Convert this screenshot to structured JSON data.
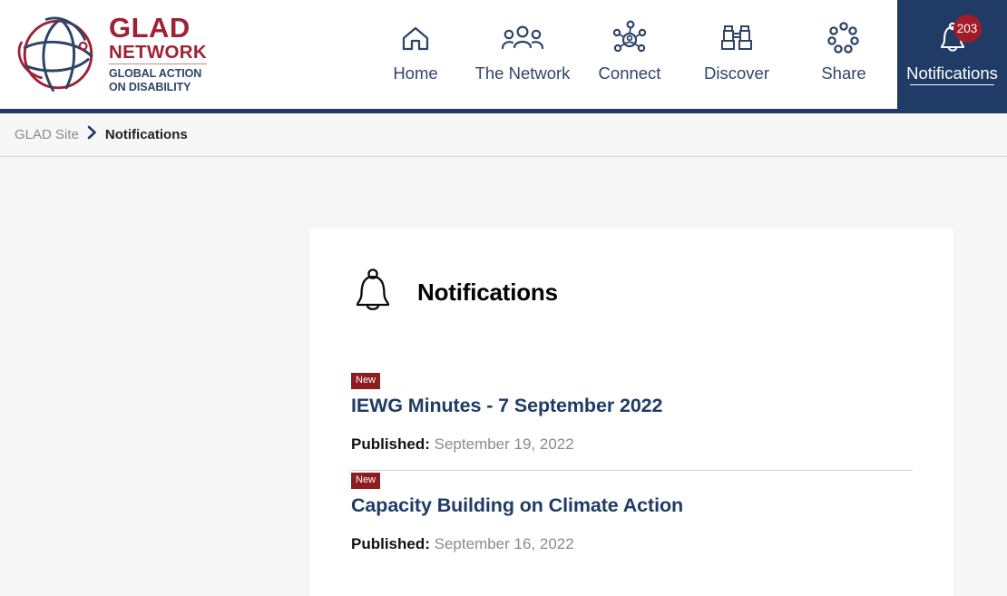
{
  "brand": {
    "logo_icon": "globe-logo-icon",
    "name_line1": "GLAD",
    "name_line2": "NETWORK",
    "tagline_line1": "GLOBAL ACTION",
    "tagline_line2": "ON DISABILITY",
    "primary_red": "#9e2235",
    "primary_navy": "#1f3b66"
  },
  "nav": {
    "items": [
      {
        "label": "Home",
        "icon": "home-icon",
        "active": false
      },
      {
        "label": "The Network",
        "icon": "people-group-icon",
        "active": false
      },
      {
        "label": "Connect",
        "icon": "network-nodes-icon",
        "active": false
      },
      {
        "label": "Discover",
        "icon": "binoculars-icon",
        "active": false
      },
      {
        "label": "Share",
        "icon": "share-ring-icon",
        "active": false
      },
      {
        "label": "Notifications",
        "icon": "bell-icon",
        "active": true,
        "badge": "203"
      }
    ]
  },
  "breadcrumb": {
    "root": "GLAD Site",
    "separator": "›",
    "current": "Notifications"
  },
  "main": {
    "icon": "bell-icon",
    "title": "Notifications",
    "published_label": "Published:",
    "new_label": "New",
    "items": [
      {
        "badge": "New",
        "title": "IEWG Minutes - 7 September 2022",
        "published_label": "Published:",
        "published_date": "September 19, 2022"
      },
      {
        "badge": "New",
        "title": "Capacity Building on Climate Action",
        "published_label": "Published:",
        "published_date": "September 16, 2022"
      }
    ]
  }
}
